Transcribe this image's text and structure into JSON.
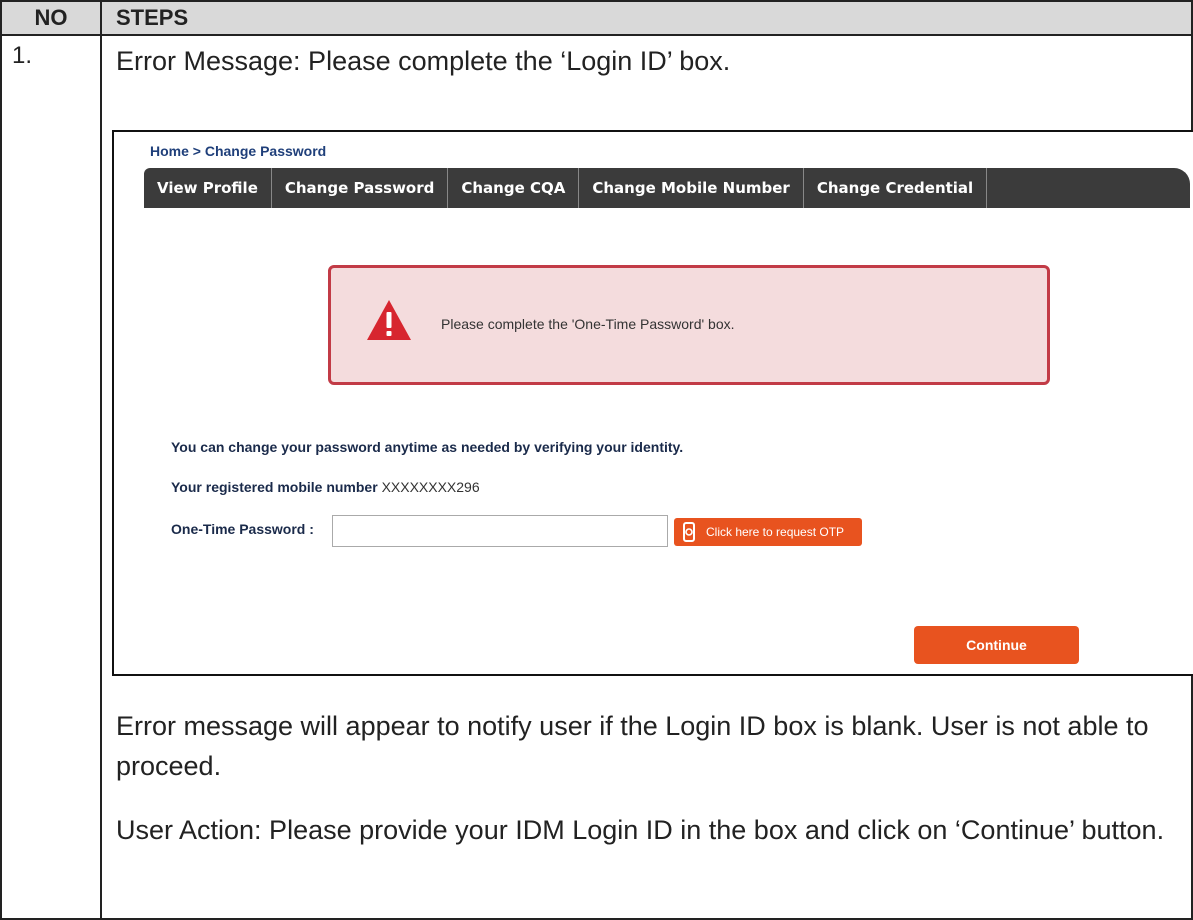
{
  "table": {
    "header_no": "NO",
    "header_steps": "STEPS"
  },
  "step": {
    "number": "1.",
    "title": "Error Message: Please complete the ‘Login ID’ box.",
    "description": "Error message will appear to notify user if the Login ID box is blank. User is not able to proceed.",
    "user_action": "User Action: Please provide your IDM Login ID in the box and click on ‘Continue’ button."
  },
  "screenshot": {
    "breadcrumb": "Home > Change Password",
    "tabs": [
      {
        "label": "View Profile"
      },
      {
        "label": "Change Password"
      },
      {
        "label": "Change CQA"
      },
      {
        "label": "Change Mobile Number"
      },
      {
        "label": "Change Credential"
      }
    ],
    "alert": {
      "message": "Please complete the 'One-Time Password' box.",
      "icon": "warning-icon"
    },
    "info_text": "You can change your password anytime as needed by verifying your identity.",
    "mobile_label": "Your registered mobile number",
    "mobile_value": "XXXXXXXX296",
    "otp_label": "One-Time Password :",
    "otp_value": "",
    "otp_button_label": "Click here to request OTP",
    "otp_button_icon": "phone-icon",
    "continue_label": "Continue",
    "colors": {
      "tab_bar": "#3b3b3b",
      "alert_border": "#c23b46",
      "alert_bg": "#f4dcdd",
      "button": "#e8531f"
    }
  }
}
